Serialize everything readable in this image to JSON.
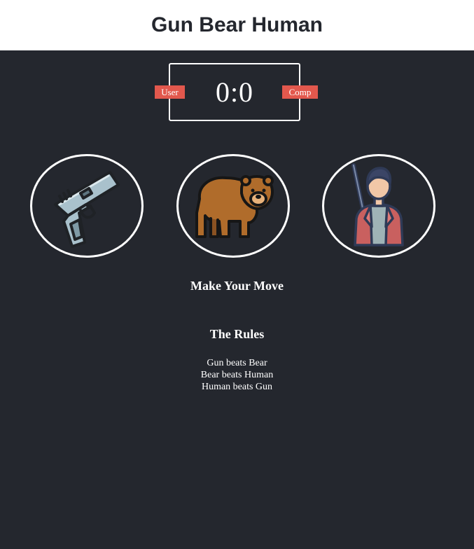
{
  "header": {
    "title": "Gun Bear Human"
  },
  "scoreboard": {
    "user_label": "User",
    "comp_label": "Comp",
    "score": "0:0",
    "badge_color": "#e2584d"
  },
  "choices": [
    {
      "id": "gun",
      "icon": "gun-icon"
    },
    {
      "id": "bear",
      "icon": "bear-icon"
    },
    {
      "id": "human",
      "icon": "hunter-icon"
    }
  ],
  "action_message": "Make Your Move",
  "rules": {
    "title": "The Rules",
    "lines": [
      "Gun beats Bear",
      "Bear beats Human",
      "Human beats Gun"
    ]
  },
  "colors": {
    "background": "#24272e",
    "header": "#ffffff",
    "accent": "#e2584d"
  }
}
